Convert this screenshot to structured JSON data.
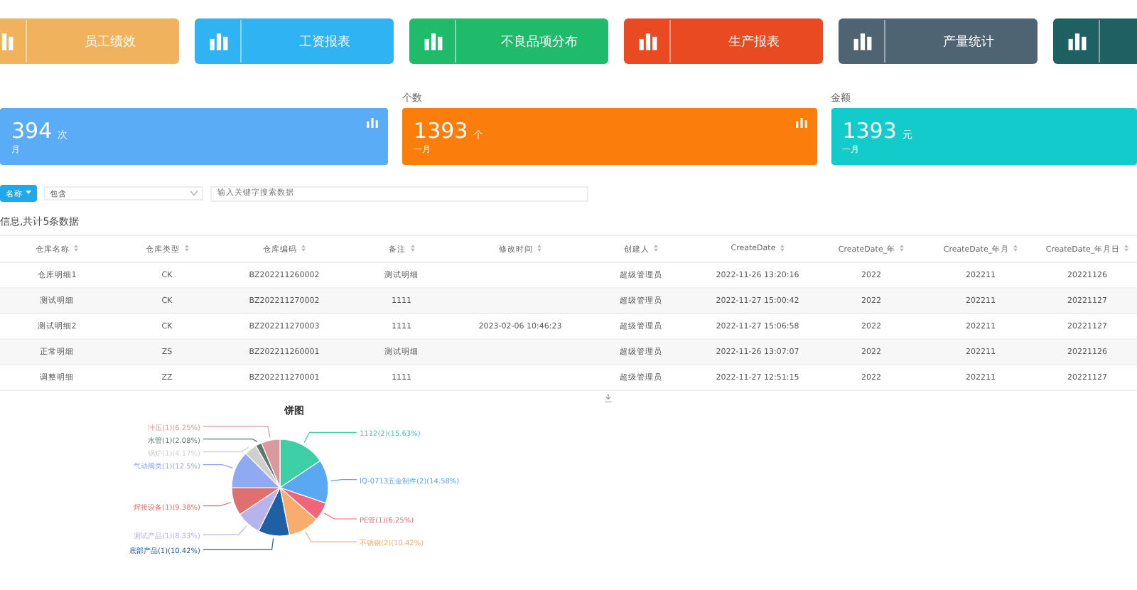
{
  "nav_cards": [
    {
      "label": "员工绩效",
      "color": "#f0b25c"
    },
    {
      "label": "工资报表",
      "color": "#2fb3f2"
    },
    {
      "label": "不良品项分布",
      "color": "#20ba6b"
    },
    {
      "label": "生产报表",
      "color": "#ea4a21"
    },
    {
      "label": "产量统计",
      "color": "#4f6473"
    },
    {
      "color": "#1f6063"
    }
  ],
  "stats": [
    {
      "value": "394",
      "unit": "次",
      "period": "月",
      "color": "#5aacf7",
      "icon": true
    },
    {
      "caption": "个数",
      "value": "1393",
      "unit": "个",
      "period": "一月",
      "color": "#fb7d0b",
      "icon": true
    },
    {
      "caption": "金额",
      "value": "1393",
      "unit": "元",
      "period": "一月",
      "color": "#14cbcb"
    }
  ],
  "toolbar": {
    "field_button": "名称",
    "operator": "包含",
    "search_placeholder": "输入关键字搜索数据"
  },
  "summary": "信息,共计5条数据",
  "table": {
    "columns": [
      "仓库名称",
      "仓库类型",
      "仓库编码",
      "备注",
      "修改时间",
      "创建人",
      "CreateDate",
      "CreateDate_年",
      "CreateDate_年月",
      "CreateDate_年月日"
    ],
    "rows": [
      [
        "仓库明细1",
        "CK",
        "BZ202211260002",
        "测试明细",
        "",
        "超级管理员",
        "2022-11-26 13:20:16",
        "2022",
        "202211",
        "20221126"
      ],
      [
        "测试明细",
        "CK",
        "BZ202211270002",
        "1111",
        "",
        "超级管理员",
        "2022-11-27 15:00:42",
        "2022",
        "202211",
        "20221127"
      ],
      [
        "测试明细2",
        "CK",
        "BZ202211270003",
        "1111",
        "2023-02-06 10:46:23",
        "超级管理员",
        "2022-11-27 15:06:58",
        "2022",
        "202211",
        "20221127"
      ],
      [
        "正常明细",
        "ZS",
        "BZ202211260001",
        "测试明细",
        "",
        "超级管理员",
        "2022-11-26 13:07:07",
        "2022",
        "202211",
        "20221126"
      ],
      [
        "调整明细",
        "ZZ",
        "BZ202211270001",
        "1111",
        "",
        "超级管理员",
        "2022-11-27 12:51:15",
        "2022",
        "202211",
        "20221127"
      ]
    ]
  },
  "pie": {
    "chart_data": {
      "type": "pie",
      "title": "饼图",
      "categories": [
        "1112(2)(15.63%)",
        "IQ-0713五金制件(2)(14.58%)",
        "PE管(1)(6.25%)",
        "不锈钢(2)(10.42%)",
        "底部产品(1)(10.42%)",
        "测试产品(1)(8.33%)",
        "焊接设备(1)(9.38%)",
        "气动阀类(1)(12.5%)",
        "锅炉(1)(4.17%)",
        "水管(1)(2.08%)",
        "冲压(1)(6.25%)"
      ],
      "values": [
        15.63,
        14.58,
        6.25,
        10.42,
        10.42,
        8.33,
        9.38,
        12.5,
        4.17,
        2.08,
        6.25
      ]
    }
  }
}
